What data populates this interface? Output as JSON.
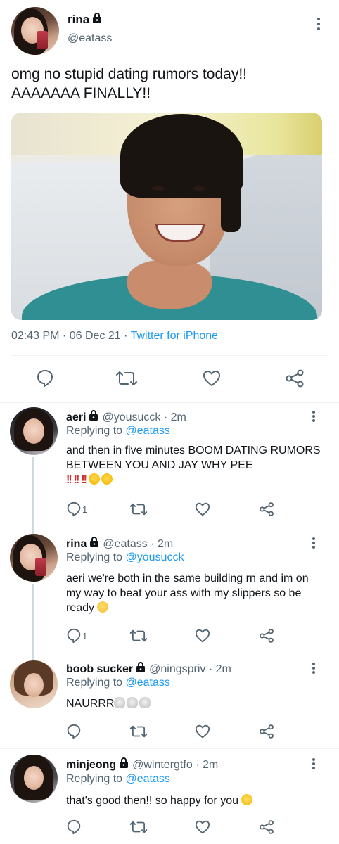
{
  "main_tweet": {
    "display_name": "rina",
    "handle": "@eatass",
    "text": "omg no stupid dating rumors today!!\nAAAAAAA FINALLY!!",
    "timestamp": "02:43 PM · 06 Dec 21 · ",
    "source": "Twitter for iPhone"
  },
  "replies": [
    {
      "display_name": "aeri",
      "handle": "@yousucck · 2m",
      "replying_prefix": "Replying to ",
      "replying_to": "@eatass",
      "text": "and then in five minutes BOOM DATING RUMORS BETWEEN YOU AND JAY WHY PEE",
      "emojis": "‼️‼️‼️🤣🤣",
      "reply_count": "1"
    },
    {
      "display_name": "rina",
      "handle": "@eatass · 2m",
      "replying_prefix": "Replying to ",
      "replying_to": "@yousucck",
      "text": "aeri we're both in the same building rn and im on my way to beat your ass with my slippers so be ready",
      "emojis": "😊",
      "reply_count": "1"
    },
    {
      "display_name": "boob sucker",
      "handle": "@ningspriv · 2m",
      "replying_prefix": "Replying to ",
      "replying_to": "@eatass",
      "text": "NAURRR",
      "emojis": "💀💀💀",
      "reply_count": ""
    },
    {
      "display_name": "minjeong",
      "handle": "@wintergtfo · 2m",
      "replying_prefix": "Replying to ",
      "replying_to": "@eatass",
      "text": "that's good then!! so happy for you",
      "emojis": "🥺",
      "reply_count": ""
    }
  ],
  "icons": {
    "reply": "reply-icon",
    "retweet": "retweet-icon",
    "like": "like-icon",
    "share": "share-icon",
    "lock": "lock-icon",
    "more": "more-icon"
  },
  "colors": {
    "link": "#1d9bf0",
    "secondary_text": "#536471",
    "primary_text": "#0f1419",
    "divider": "#eff3f4"
  }
}
